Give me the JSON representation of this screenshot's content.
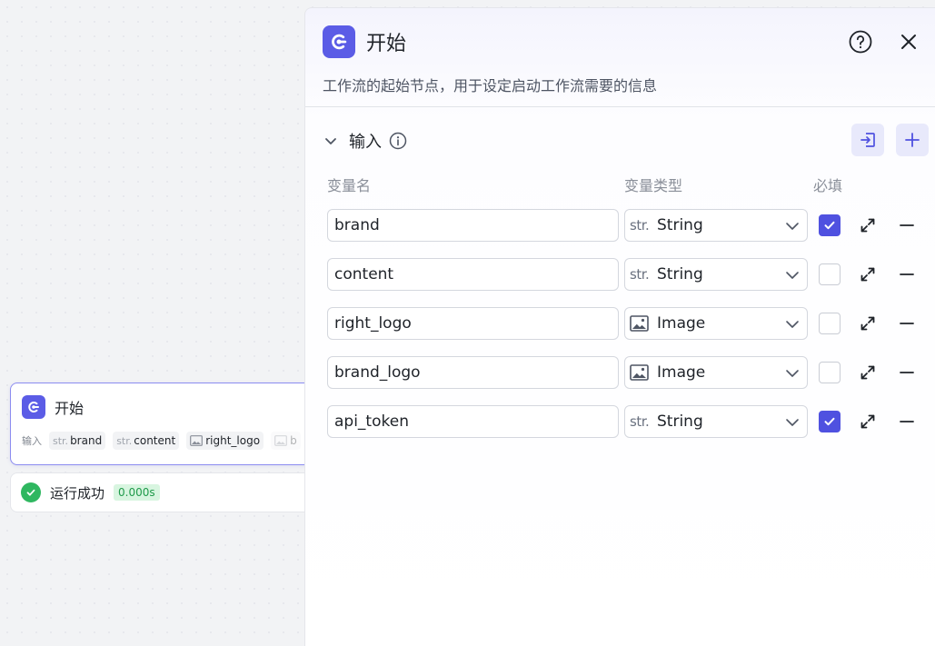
{
  "node": {
    "title": "开始",
    "inputs_label": "输入",
    "chips": [
      {
        "type": "str.",
        "name": "brand"
      },
      {
        "type": "str.",
        "name": "content"
      },
      {
        "type": "image",
        "name": "right_logo"
      },
      {
        "type": "image",
        "name": "b"
      }
    ]
  },
  "run": {
    "status": "运行成功",
    "duration": "0.000s"
  },
  "panel": {
    "title": "开始",
    "description": "工作流的起始节点，用于设定启动工作流需要的信息",
    "section_title": "输入",
    "columns": {
      "name": "变量名",
      "type": "变量类型",
      "required": "必填"
    },
    "rows": [
      {
        "name": "brand",
        "type": "String",
        "type_icon": "str.",
        "required": true
      },
      {
        "name": "content",
        "type": "String",
        "type_icon": "str.",
        "required": false
      },
      {
        "name": "right_logo",
        "type": "Image",
        "type_icon": "image-icon",
        "required": false
      },
      {
        "name": "brand_logo",
        "type": "Image",
        "type_icon": "image-icon",
        "required": false
      },
      {
        "name": "api_token",
        "type": "String",
        "type_icon": "str.",
        "required": true
      }
    ]
  },
  "colors": {
    "accent": "#4f51e0",
    "brand": "#5b5ce6",
    "success": "#2fb760"
  }
}
